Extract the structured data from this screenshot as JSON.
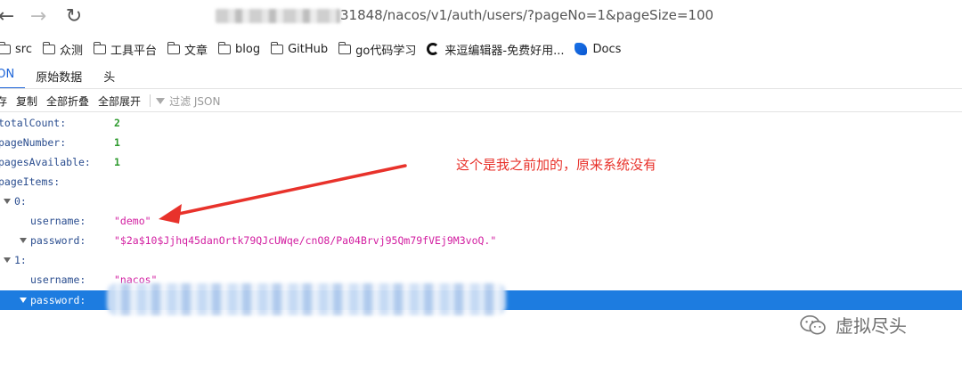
{
  "browser": {
    "url_visible": "31848/nacos/v1/auth/users/?pageNo=1&pageSize=100"
  },
  "bookmarks": [
    {
      "label": "src",
      "icon": "folder-icon"
    },
    {
      "label": "众测",
      "icon": "folder-icon"
    },
    {
      "label": "工具平台",
      "icon": "folder-icon"
    },
    {
      "label": "文章",
      "icon": "folder-icon"
    },
    {
      "label": "blog",
      "icon": "folder-icon"
    },
    {
      "label": "GitHub",
      "icon": "folder-icon"
    },
    {
      "label": "go代码学习",
      "icon": "folder-icon"
    },
    {
      "label": "来逗编辑器-免费好用...",
      "icon": "site-spinner-icon"
    },
    {
      "label": "Docs",
      "icon": "docs-icon"
    }
  ],
  "viewer_tabs": [
    "SON",
    "原始数据",
    "头"
  ],
  "toolbar": {
    "save": "存",
    "copy": "复制",
    "collapse_all": "全部折叠",
    "expand_all": "全部展开",
    "filter_placeholder": "过滤 JSON"
  },
  "json": {
    "totalCount_key": "totalCount:",
    "totalCount_val": "2",
    "pageNumber_key": "pageNumber:",
    "pageNumber_val": "1",
    "pagesAvailable_key": "pagesAvailable:",
    "pagesAvailable_val": "1",
    "pageItems_key": "pageItems:",
    "item0_key": "0:",
    "item0_username_key": "username:",
    "item0_username_val": "\"demo\"",
    "item0_password_key": "password:",
    "item0_password_val": "\"$2a$10$Jjhq45danOrtk79QJcUWqe/cnO8/Pa04Brvj95Qm79fVEj9M3voQ.\"",
    "item1_key": "1:",
    "item1_username_key": "username:",
    "item1_username_val": "\"nacos\"",
    "item1_password_key": "password:"
  },
  "annotation": "这个是我之前加的，原来系统没有",
  "watermark": "虚拟尽头",
  "colors": {
    "accent": "#1d64d8",
    "selected_row": "#1d7ce0",
    "number": "#2e9a2e",
    "string": "#d21da0",
    "annotation": "#e8322b"
  }
}
